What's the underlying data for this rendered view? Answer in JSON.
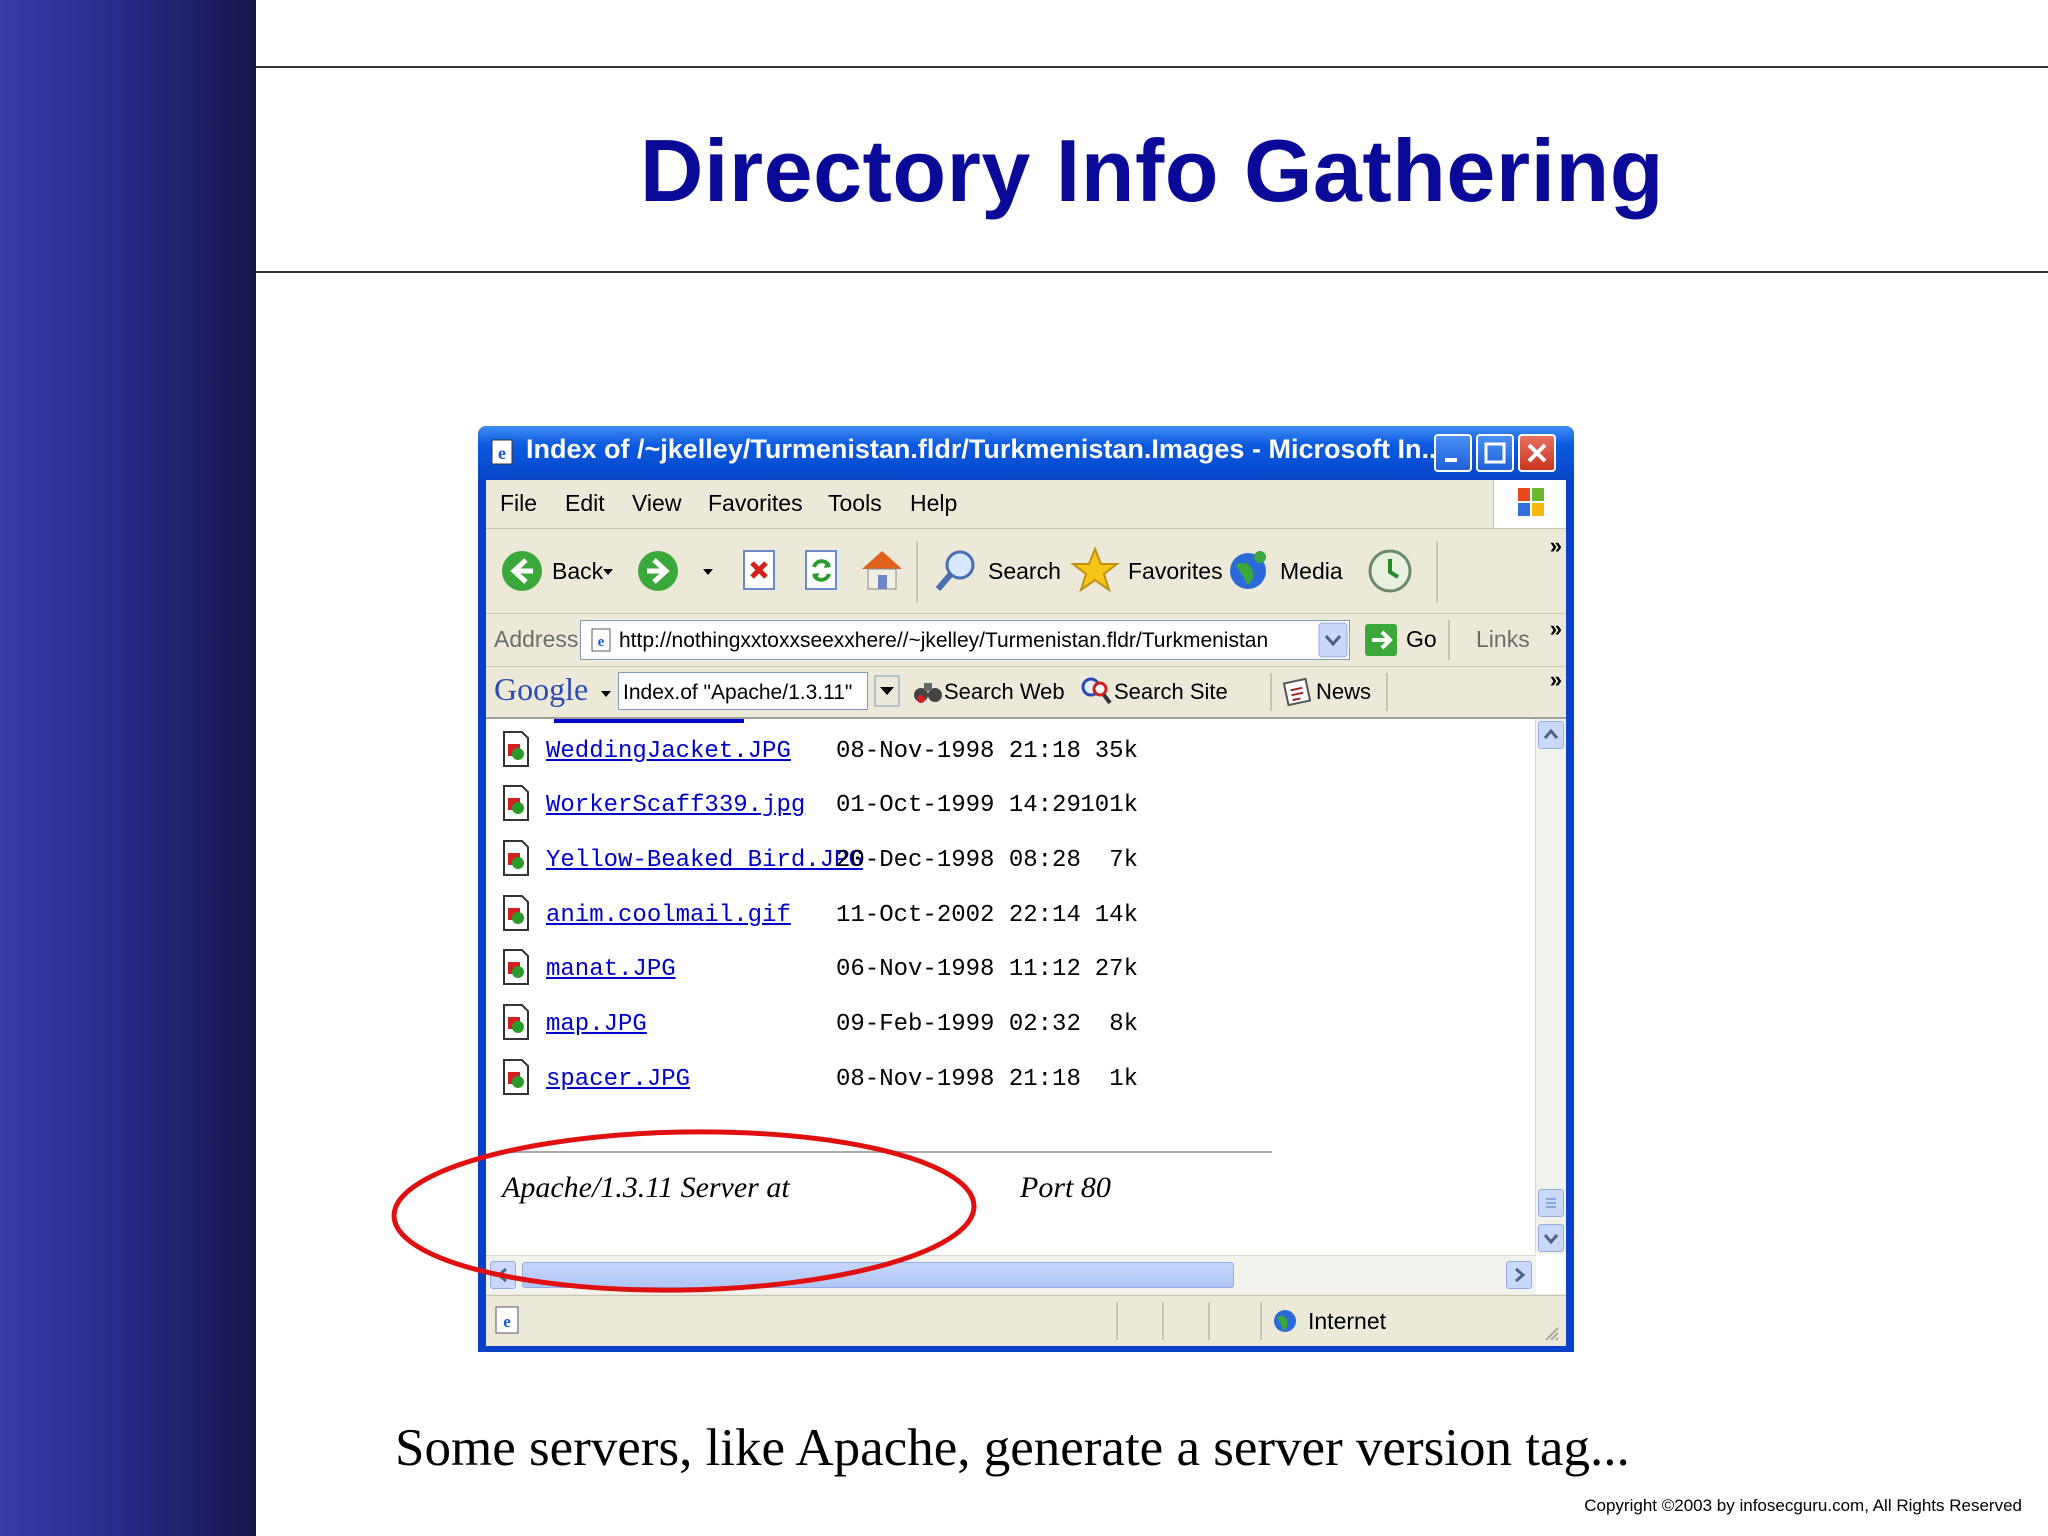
{
  "slide": {
    "title": "Directory Info Gathering",
    "caption": "Some servers, like Apache, generate a server version tag...",
    "copyright": "Copyright  ©2003 by infosecguru.com, All Rights Reserved"
  },
  "browser": {
    "window_title": "Index of /~jkelley/Turmenistan.fldr/Turkmenistan.Images - Microsoft In...",
    "menu": [
      "File",
      "Edit",
      "View",
      "Favorites",
      "Tools",
      "Help"
    ],
    "toolbar": {
      "back_label": "Back",
      "search_label": "Search",
      "favorites_label": "Favorites",
      "media_label": "Media",
      "chevron": "»"
    },
    "address_bar": {
      "label": "Address",
      "url": "http://nothingxxtoxxseexxhere//~jkelley/Turmenistan.fldr/Turkmenistan",
      "go_label": "Go",
      "links_label": "Links",
      "chevron": "»"
    },
    "google_bar": {
      "logo": "Google",
      "query": "Index.of \"Apache/1.3.11\"",
      "search_web": "Search Web",
      "search_site": "Search Site",
      "news": "News",
      "chevron": "»"
    },
    "listing": [
      {
        "name": "WeddingJacket.JPG",
        "date": "08-Nov-1998 21:18",
        "size": "35k"
      },
      {
        "name": "WorkerScaff339.jpg",
        "date": "01-Oct-1999 14:29",
        "size": "101k"
      },
      {
        "name": "Yellow-Beaked Bird.JPG",
        "date": "20-Dec-1998 08:28",
        "size": "7k"
      },
      {
        "name": "anim.coolmail.gif",
        "date": "11-Oct-2002 22:14",
        "size": "14k"
      },
      {
        "name": "manat.JPG",
        "date": "06-Nov-1998 11:12",
        "size": "27k"
      },
      {
        "name": "map.JPG",
        "date": "09-Feb-1999 02:32",
        "size": "8k"
      },
      {
        "name": "spacer.JPG",
        "date": "08-Nov-1998 21:18",
        "size": "1k"
      }
    ],
    "server_signature": "Apache/1.3.11 Server at",
    "server_port": "Port 80",
    "status_zone": "Internet"
  },
  "colors": {
    "title_blue": "#0a0a99",
    "highlight_ellipse": "#e01010",
    "link_blue": "#0000cc"
  }
}
